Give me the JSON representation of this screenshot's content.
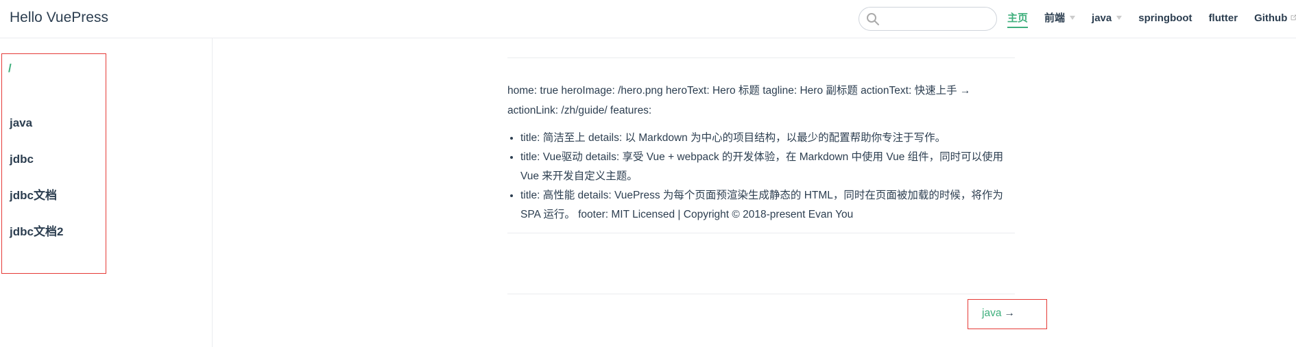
{
  "header": {
    "site_title": "Hello VuePress",
    "search": {
      "value": "",
      "placeholder": ""
    },
    "nav": [
      {
        "label": "主页",
        "active": true
      },
      {
        "label": "前端",
        "dropdown": true
      },
      {
        "label": "java",
        "dropdown": true
      },
      {
        "label": "springboot"
      },
      {
        "label": "flutter"
      },
      {
        "label": "Github",
        "external": true
      }
    ]
  },
  "sidebar": {
    "root_link": "/",
    "items": [
      {
        "label": "java"
      },
      {
        "label": "jdbc"
      },
      {
        "label": "jdbc文档"
      },
      {
        "label": "jdbc文档2"
      }
    ]
  },
  "content": {
    "frontmatter_line1": "home: true heroImage: /hero.png heroText: Hero 标题 tagline: Hero 副标题 actionText: 快速上手 →",
    "frontmatter_line2": "actionLink: /zh/guide/ features:",
    "features": [
      "title: 简洁至上 details: 以 Markdown 为中心的项目结构，以最少的配置帮助你专注于写作。",
      "title: Vue驱动 details: 享受 Vue + webpack 的开发体验，在 Markdown 中使用 Vue 组件，同时可以使用 Vue 来开发自定义主题。",
      "title: 高性能 details: VuePress 为每个页面预渲染生成静态的 HTML，同时在页面被加载的时候，将作为 SPA 运行。 footer: MIT Licensed | Copyright © 2018-present Evan You"
    ]
  },
  "page_nav": {
    "next_label": "java",
    "next_arrow": "→"
  },
  "colors": {
    "accent": "#3eaf7c",
    "text": "#2c3e50",
    "highlight_box": "#e53935",
    "border": "#eaecef"
  }
}
